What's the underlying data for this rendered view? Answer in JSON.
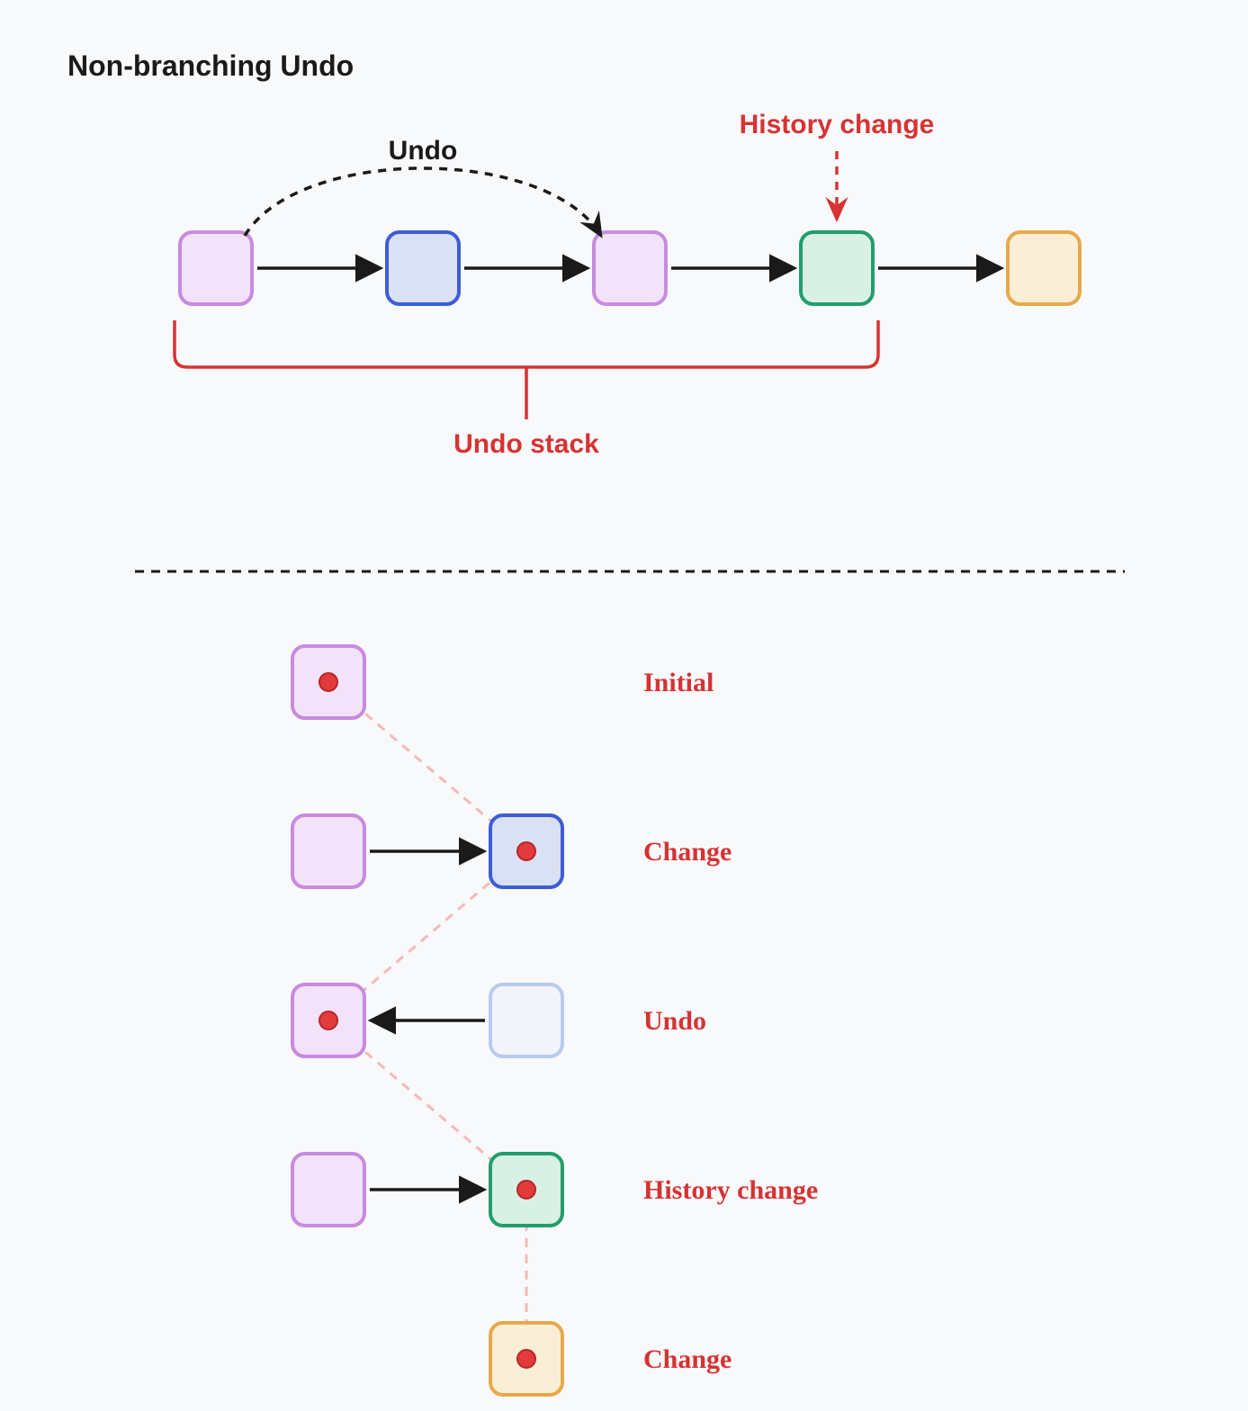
{
  "title": "Non-branching Undo",
  "top": {
    "undo_label": "Undo",
    "history_change_label": "History change",
    "undo_stack_label": "Undo stack",
    "nodes": [
      {
        "id": "n1",
        "color": "purple"
      },
      {
        "id": "n2",
        "color": "blue"
      },
      {
        "id": "n3",
        "color": "purple"
      },
      {
        "id": "n4",
        "color": "green"
      },
      {
        "id": "n5",
        "color": "orange"
      }
    ]
  },
  "steps": [
    {
      "label": "Initial",
      "boxes": [
        {
          "col": 0,
          "color": "purple",
          "dot": true
        }
      ]
    },
    {
      "label": "Change",
      "boxes": [
        {
          "col": 0,
          "color": "purple"
        },
        {
          "col": 1,
          "color": "blue",
          "dot": true
        }
      ],
      "arrow": "right"
    },
    {
      "label": "Undo",
      "boxes": [
        {
          "col": 0,
          "color": "purple",
          "dot": true
        },
        {
          "col": 1,
          "color": "blue-faded"
        }
      ],
      "arrow": "left"
    },
    {
      "label": "History change",
      "boxes": [
        {
          "col": 0,
          "color": "purple"
        },
        {
          "col": 1,
          "color": "green",
          "dot": true
        }
      ],
      "arrow": "right"
    },
    {
      "label": "Change",
      "boxes": [
        {
          "col": 1,
          "color": "orange",
          "dot": true
        }
      ]
    }
  ],
  "colors": {
    "purple_stroke": "#c98ae0",
    "purple_fill": "#f3e3fa",
    "blue_stroke": "#3d5cd6",
    "blue_fill": "#dbe1f5",
    "blue_faded_stroke": "#b9cbed",
    "blue_faded_fill": "#f1f4fb",
    "green_stroke": "#219e6c",
    "green_fill": "#d9f0e4",
    "orange_stroke": "#e6a94a",
    "orange_fill": "#fbeed6",
    "red": "#d63333",
    "black": "#1a1a1a",
    "red_dot": "#e33b3b"
  }
}
